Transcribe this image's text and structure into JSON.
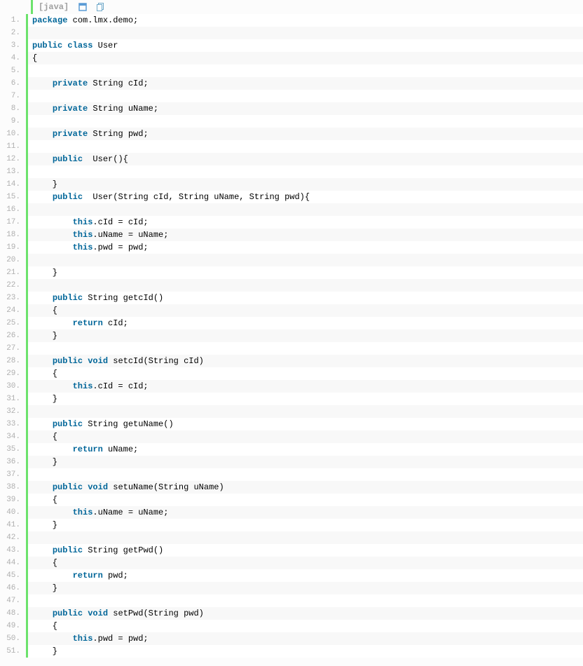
{
  "header": {
    "language_label": "[java]",
    "icons": [
      "view-source-icon",
      "copy-icon"
    ]
  },
  "code": {
    "lines": [
      [
        {
          "t": "package",
          "c": "kw"
        },
        {
          "t": " com.lmx.demo;",
          "c": "plain"
        }
      ],
      [],
      [
        {
          "t": "public",
          "c": "kw"
        },
        {
          "t": " ",
          "c": "plain"
        },
        {
          "t": "class",
          "c": "kw"
        },
        {
          "t": " User",
          "c": "plain"
        }
      ],
      [
        {
          "t": "{",
          "c": "plain"
        }
      ],
      [],
      [
        {
          "t": "    ",
          "c": "plain"
        },
        {
          "t": "private",
          "c": "kw"
        },
        {
          "t": " String cId;",
          "c": "plain"
        }
      ],
      [],
      [
        {
          "t": "    ",
          "c": "plain"
        },
        {
          "t": "private",
          "c": "kw"
        },
        {
          "t": " String uName;",
          "c": "plain"
        }
      ],
      [],
      [
        {
          "t": "    ",
          "c": "plain"
        },
        {
          "t": "private",
          "c": "kw"
        },
        {
          "t": " String pwd;",
          "c": "plain"
        }
      ],
      [],
      [
        {
          "t": "    ",
          "c": "plain"
        },
        {
          "t": "public",
          "c": "kw"
        },
        {
          "t": "  User(){",
          "c": "plain"
        }
      ],
      [],
      [
        {
          "t": "    }",
          "c": "plain"
        }
      ],
      [
        {
          "t": "    ",
          "c": "plain"
        },
        {
          "t": "public",
          "c": "kw"
        },
        {
          "t": "  User(String cId, String uName, String pwd){",
          "c": "plain"
        }
      ],
      [],
      [
        {
          "t": "        ",
          "c": "plain"
        },
        {
          "t": "this",
          "c": "kw"
        },
        {
          "t": ".cId = cId;",
          "c": "plain"
        }
      ],
      [
        {
          "t": "        ",
          "c": "plain"
        },
        {
          "t": "this",
          "c": "kw"
        },
        {
          "t": ".uName = uName;",
          "c": "plain"
        }
      ],
      [
        {
          "t": "        ",
          "c": "plain"
        },
        {
          "t": "this",
          "c": "kw"
        },
        {
          "t": ".pwd = pwd;",
          "c": "plain"
        }
      ],
      [],
      [
        {
          "t": "    }",
          "c": "plain"
        }
      ],
      [],
      [
        {
          "t": "    ",
          "c": "plain"
        },
        {
          "t": "public",
          "c": "kw"
        },
        {
          "t": " String getcId()",
          "c": "plain"
        }
      ],
      [
        {
          "t": "    {",
          "c": "plain"
        }
      ],
      [
        {
          "t": "        ",
          "c": "plain"
        },
        {
          "t": "return",
          "c": "kw"
        },
        {
          "t": " cId;",
          "c": "plain"
        }
      ],
      [
        {
          "t": "    }",
          "c": "plain"
        }
      ],
      [],
      [
        {
          "t": "    ",
          "c": "plain"
        },
        {
          "t": "public",
          "c": "kw"
        },
        {
          "t": " ",
          "c": "plain"
        },
        {
          "t": "void",
          "c": "kw"
        },
        {
          "t": " setcId(String cId)",
          "c": "plain"
        }
      ],
      [
        {
          "t": "    {",
          "c": "plain"
        }
      ],
      [
        {
          "t": "        ",
          "c": "plain"
        },
        {
          "t": "this",
          "c": "kw"
        },
        {
          "t": ".cId = cId;",
          "c": "plain"
        }
      ],
      [
        {
          "t": "    }",
          "c": "plain"
        }
      ],
      [],
      [
        {
          "t": "    ",
          "c": "plain"
        },
        {
          "t": "public",
          "c": "kw"
        },
        {
          "t": " String getuName()",
          "c": "plain"
        }
      ],
      [
        {
          "t": "    {",
          "c": "plain"
        }
      ],
      [
        {
          "t": "        ",
          "c": "plain"
        },
        {
          "t": "return",
          "c": "kw"
        },
        {
          "t": " uName;",
          "c": "plain"
        }
      ],
      [
        {
          "t": "    }",
          "c": "plain"
        }
      ],
      [],
      [
        {
          "t": "    ",
          "c": "plain"
        },
        {
          "t": "public",
          "c": "kw"
        },
        {
          "t": " ",
          "c": "plain"
        },
        {
          "t": "void",
          "c": "kw"
        },
        {
          "t": " setuName(String uName)",
          "c": "plain"
        }
      ],
      [
        {
          "t": "    {",
          "c": "plain"
        }
      ],
      [
        {
          "t": "        ",
          "c": "plain"
        },
        {
          "t": "this",
          "c": "kw"
        },
        {
          "t": ".uName = uName;",
          "c": "plain"
        }
      ],
      [
        {
          "t": "    }",
          "c": "plain"
        }
      ],
      [],
      [
        {
          "t": "    ",
          "c": "plain"
        },
        {
          "t": "public",
          "c": "kw"
        },
        {
          "t": " String getPwd()",
          "c": "plain"
        }
      ],
      [
        {
          "t": "    {",
          "c": "plain"
        }
      ],
      [
        {
          "t": "        ",
          "c": "plain"
        },
        {
          "t": "return",
          "c": "kw"
        },
        {
          "t": " pwd;",
          "c": "plain"
        }
      ],
      [
        {
          "t": "    }",
          "c": "plain"
        }
      ],
      [],
      [
        {
          "t": "    ",
          "c": "plain"
        },
        {
          "t": "public",
          "c": "kw"
        },
        {
          "t": " ",
          "c": "plain"
        },
        {
          "t": "void",
          "c": "kw"
        },
        {
          "t": " setPwd(String pwd)",
          "c": "plain"
        }
      ],
      [
        {
          "t": "    {",
          "c": "plain"
        }
      ],
      [
        {
          "t": "        ",
          "c": "plain"
        },
        {
          "t": "this",
          "c": "kw"
        },
        {
          "t": ".pwd = pwd;",
          "c": "plain"
        }
      ],
      [
        {
          "t": "    }",
          "c": "plain"
        }
      ]
    ]
  }
}
